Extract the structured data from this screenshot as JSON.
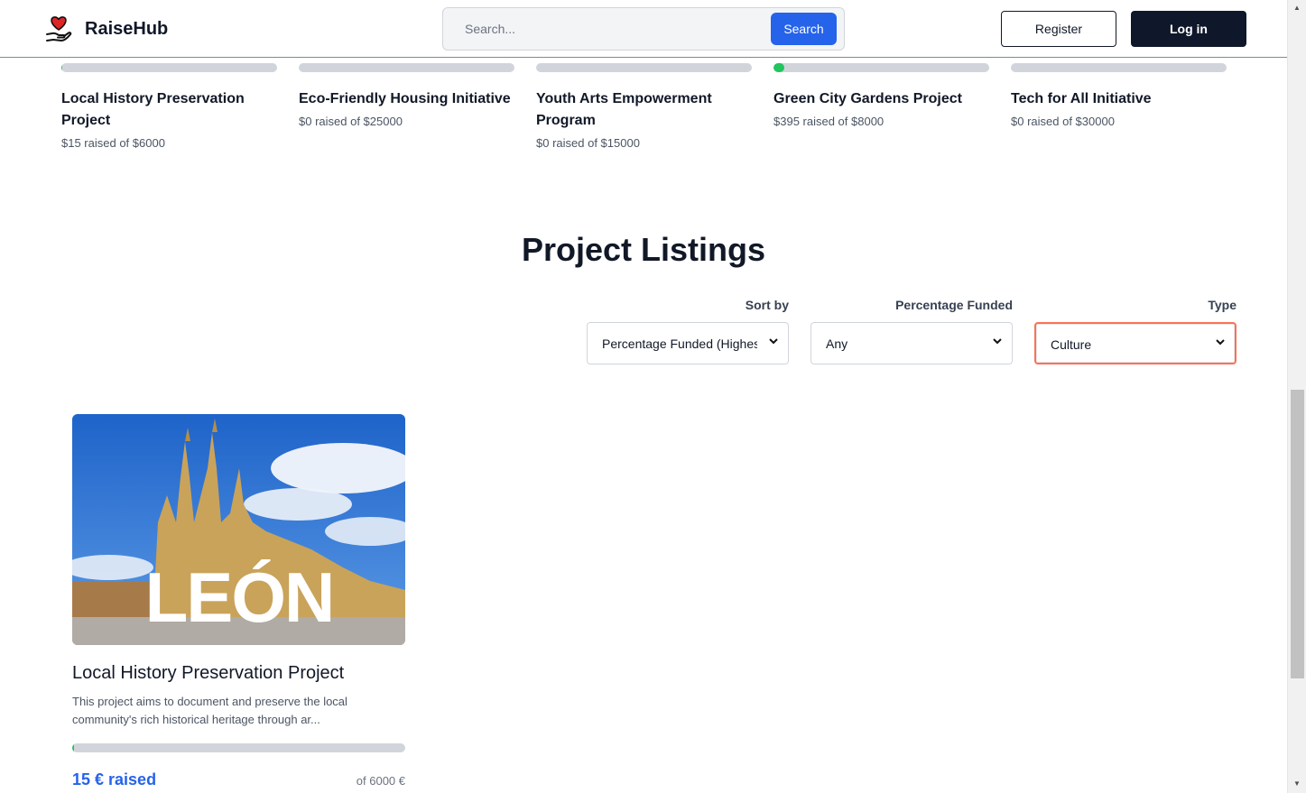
{
  "brand": {
    "name": "RaiseHub",
    "icon": "heart-hand-icon",
    "heart_color": "#dc2626"
  },
  "header": {
    "search_placeholder": "Search...",
    "search_button": "Search",
    "register": "Register",
    "login": "Log in"
  },
  "featured": [
    {
      "title": "Local History Preservation Project",
      "raised": "$15 raised of $6000",
      "progress": 0.0025
    },
    {
      "title": "Eco-Friendly Housing Initiative",
      "raised": "$0 raised of $25000",
      "progress": 0
    },
    {
      "title": "Youth Arts Empowerment Program",
      "raised": "$0 raised of $15000",
      "progress": 0
    },
    {
      "title": "Green City Gardens Project",
      "raised": "$395 raised of $8000",
      "progress": 0.049
    },
    {
      "title": "Tech for All Initiative",
      "raised": "$0 raised of $30000",
      "progress": 0
    }
  ],
  "listings": {
    "title": "Project Listings",
    "filters": {
      "sort_label": "Sort by",
      "sort_value": "Percentage Funded (Highest)",
      "funded_label": "Percentage Funded",
      "funded_value": "Any",
      "type_label": "Type",
      "type_value": "Culture"
    },
    "cards": [
      {
        "image_text": "LEÓN",
        "title": "Local History Preservation Project",
        "description": "This project aims to document and preserve the local community's rich historical heritage through ar...",
        "raised": "15 € raised",
        "goal": "of 6000 €",
        "progress": 0.0025
      }
    ]
  },
  "colors": {
    "accent": "#2563eb",
    "progress": "#22c55e",
    "focus_ring": "#f97352"
  }
}
